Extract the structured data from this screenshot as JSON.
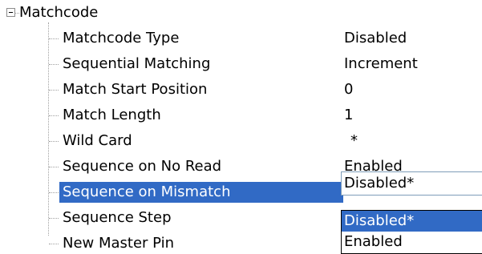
{
  "tree": {
    "root": {
      "label": "Matchcode",
      "expanded": true
    },
    "items": [
      {
        "name": "Matchcode Type",
        "value": "Disabled"
      },
      {
        "name": "Sequential Matching",
        "value": "Increment"
      },
      {
        "name": "Match Start Position",
        "value": "0"
      },
      {
        "name": "Match Length",
        "value": "1"
      },
      {
        "name": "Wild Card",
        "value": "*"
      },
      {
        "name": "Sequence on No Read",
        "value": "Enabled"
      },
      {
        "name": "Sequence on Mismatch",
        "value": "Disabled*",
        "selected": true
      },
      {
        "name": "Sequence Step",
        "value": ""
      },
      {
        "name": "New Master Pin",
        "value": ""
      }
    ]
  },
  "editor": {
    "combo_value": "Disabled*",
    "options": [
      "Disabled*",
      "Enabled"
    ],
    "highlighted_option": "Disabled*"
  },
  "colors": {
    "selection": "#316ac5",
    "selection_text": "#ffffff",
    "tree_lines": "#a0a0a0"
  }
}
